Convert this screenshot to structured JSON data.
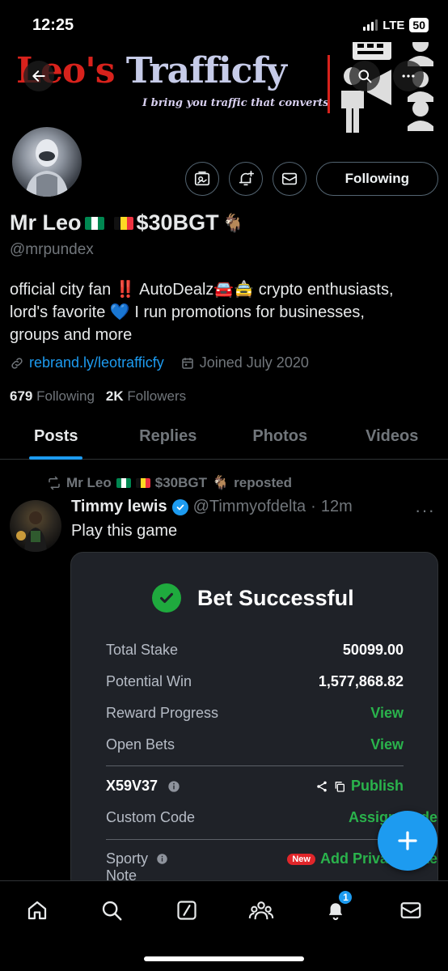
{
  "status_bar": {
    "time": "12:25",
    "network": "LTE",
    "battery": "50"
  },
  "banner": {
    "title_part1": "Leo's",
    "title_part2": "Trafficfy",
    "subtitle": "I bring you traffic that converts"
  },
  "profile": {
    "display_name": "Mr Leo",
    "name_suffix": "$30BGT",
    "handle": "@mrpundex",
    "bio_line1": "official city fan ‼️ AutoDealz🚘🚖 crypto enthusiasts,",
    "bio_line2": "lord's favorite 💙 I run promotions for businesses,",
    "bio_line3": "groups and more",
    "link": "rebrand.ly/leotrafficfy",
    "joined": "Joined July 2020",
    "following_count": "679",
    "following_label": "Following",
    "followers_count": "2K",
    "followers_label": "Followers",
    "follow_button_label": "Following"
  },
  "tabs": [
    "Posts",
    "Replies",
    "Photos",
    "Videos"
  ],
  "post": {
    "repost_by": "Mr Leo",
    "repost_suffix": "$30BGT",
    "repost_label": "reposted",
    "author_name": "Timmy lewis",
    "author_handle": "@Timmyofdelta",
    "time": "12m",
    "text": "Play this game",
    "card": {
      "title": "Bet Successful",
      "rows": [
        {
          "label": "Total Stake",
          "value": "50099.00"
        },
        {
          "label": "Potential Win",
          "value": "1,577,868.82"
        },
        {
          "label": "Reward Progress",
          "value": "View"
        },
        {
          "label": "Open Bets",
          "value": "View"
        }
      ],
      "code": "X59V37",
      "publish": "Publish",
      "custom_code_label": "Custom Code",
      "custom_code_value": "Assign Code",
      "sporty_label": "Sporty",
      "note_label": "Note",
      "new_badge": "New",
      "add_private": "Add Private Note"
    }
  },
  "notifications_badge": "1",
  "colors": {
    "accent": "#1d9bf0",
    "success": "#2ab34c",
    "danger": "#e0262a",
    "banner_red": "#d8221c"
  }
}
